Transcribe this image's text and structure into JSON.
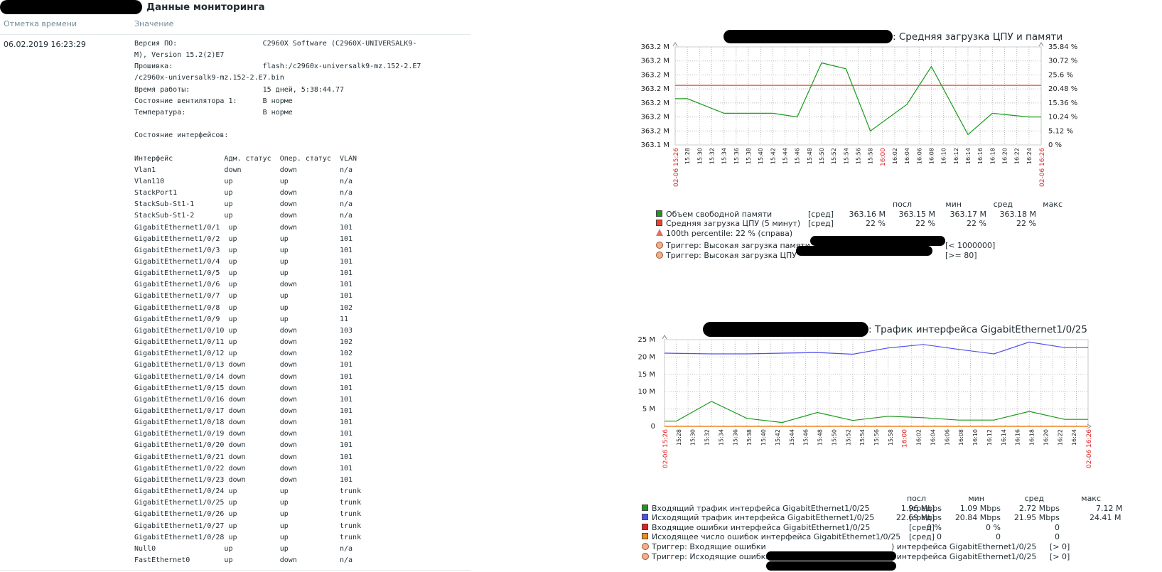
{
  "page": {
    "title_suffix": "Данные мониторинга",
    "col_time": "Отметка времени",
    "col_value": "Значение",
    "timestamp": "06.02.2019 16:23:29",
    "value_text": "Версия ПО:                    C2960X Software (C2960X-UNIVERSALK9-\nM), Version 15.2(2)E7\nПрошивка:                     flash:/c2960x-universalk9-mz.152-2.E7\n/c2960x-universalk9-mz.152-2.E7.bin\nВремя работы:                 15 дней, 5:38:44.77\nСостояние вентилятора 1:      В норме\nТемпература:                  В норме\n\nСостояние интерфейсов:\n\nИнтерфейс            Адм. статус  Опер. статус  VLAN\nVlan1                down         down          n/a\nVlan110              up           up            n/a\nStackPort1           up           down          n/a\nStackSub-St1-1       up           down          n/a\nStackSub-St1-2       up           down          n/a\nGigabitEthernet1/0/1  up          down          101\nGigabitEthernet1/0/2  up          up            101\nGigabitEthernet1/0/3  up          up            101\nGigabitEthernet1/0/4  up          up            101\nGigabitEthernet1/0/5  up          up            101\nGigabitEthernet1/0/6  up          down          101\nGigabitEthernet1/0/7  up          up            101\nGigabitEthernet1/0/8  up          up            102\nGigabitEthernet1/0/9  up          up            11\nGigabitEthernet1/0/10 up          down          103\nGigabitEthernet1/0/11 up          down          102\nGigabitEthernet1/0/12 up          down          102\nGigabitEthernet1/0/13 down        down          101\nGigabitEthernet1/0/14 down        down          101\nGigabitEthernet1/0/15 down        down          101\nGigabitEthernet1/0/16 down        down          101\nGigabitEthernet1/0/17 down        down          101\nGigabitEthernet1/0/18 down        down          101\nGigabitEthernet1/0/19 down        down          101\nGigabitEthernet1/0/20 down        down          101\nGigabitEthernet1/0/21 down        down          101\nGigabitEthernet1/0/22 down        down          101\nGigabitEthernet1/0/23 down        down          101\nGigabitEthernet1/0/24 up          up            trunk\nGigabitEthernet1/0/25 up          up            trunk\nGigabitEthernet1/0/26 up          up            trunk\nGigabitEthernet1/0/27 up          up            trunk\nGigabitEthernet1/0/28 up          up            trunk\nNull0                up           up            n/a\nFastEthernet0        up           down          n/a"
  },
  "graph1": {
    "title": ": Средняя загрузка ЦПУ  и памяти",
    "legend_header": [
      "посл",
      "мин",
      "сред",
      "макс"
    ],
    "items": [
      {
        "label": "Объем свободной памяти",
        "agg": "[сред]",
        "last": "363.16 M",
        "min": "363.15 M",
        "avg": "363.17 M",
        "max": "363.18 M",
        "color": "#1a9a1a"
      },
      {
        "label": "Средняя загрузка ЦПУ (5 минут)",
        "agg": "[сред]",
        "last": "22 %",
        "min": "22 %",
        "avg": "22 %",
        "max": "22 %",
        "color": "#e8442a"
      }
    ],
    "percentile": "100th percentile: 22 % (справа)",
    "triggers": [
      {
        "label": "Триггер: Высокая загрузка памяти",
        "cond": "[< 1000000]"
      },
      {
        "label": "Триггер: Высокая загрузка ЦПУ",
        "cond": "[>= 80]"
      }
    ]
  },
  "graph2": {
    "title": ": Трафик интерфейса GigabitEthernet1/0/25",
    "legend_header": [
      "посл",
      "мин",
      "сред",
      "макс"
    ],
    "items": [
      {
        "label": "Входящий трафик интерфейса GigabitEthernet1/0/25",
        "agg": "[сред]",
        "last": "1.96 Mbps",
        "min": "1.09 Mbps",
        "avg": "2.72 Mbps",
        "max": "7.12 M",
        "color": "#1a9a1a"
      },
      {
        "label": "Исходящий трафик интерфейса GigabitEthernet1/0/25",
        "agg": "[сред]",
        "last": "22.69 Mbps",
        "min": "20.84 Mbps",
        "avg": "21.95 Mbps",
        "max": "24.41 M",
        "color": "#5050f0"
      },
      {
        "label": "Входящие ошибки интерфейса GigabitEthernet1/0/25",
        "agg": "[сред]",
        "last": "0 %",
        "min": "0 %",
        "avg": "0",
        "max": "",
        "color": "#e02020"
      },
      {
        "label": "Исходящее число ошибок интерфейса GigabitEthernet1/0/25",
        "agg": "[сред]",
        "last": "0",
        "min": "0",
        "avg": "0",
        "max": "",
        "color": "#f08c1a"
      }
    ],
    "triggers": [
      {
        "label": "Триггер: Входящие ошибки",
        "tail": ") интерфейса GigabitEthernet1/0/25",
        "cond": "[> 0]"
      },
      {
        "label": "Триггер: Исходящие ошибки",
        "tail": ") интерфейса GigabitEthernet1/0/25",
        "cond": "[> 0]"
      }
    ]
  },
  "chart_data": [
    {
      "type": "line",
      "title": ": Средняя загрузка ЦПУ  и памяти",
      "x": [
        "15:26",
        "15:28",
        "15:30",
        "15:32",
        "15:34",
        "15:36",
        "15:38",
        "15:40",
        "15:42",
        "15:44",
        "15:46",
        "15:48",
        "15:50",
        "15:52",
        "15:54",
        "15:56",
        "15:58",
        "16:00",
        "16:02",
        "16:04",
        "16:06",
        "16:08",
        "16:10",
        "16:12",
        "16:14",
        "16:16",
        "16:18",
        "16:20",
        "16:22",
        "16:24",
        "16:26"
      ],
      "x_edge_labels": [
        "02-06 15:26",
        "02-06 16:26"
      ],
      "x_highlight": "16:00",
      "left_ticks": [
        "363.2 M",
        "363.2 M",
        "363.2 M",
        "363.2 M",
        "363.2 M",
        "363.2 M",
        "363.2 M",
        "363.1 M"
      ],
      "right_ticks": [
        "35.84 %",
        "30.72 %",
        "25.6 %",
        "20.48 %",
        "15.36 %",
        "10.24 %",
        "5.12 %",
        "0 %"
      ],
      "series": [
        {
          "name": "Объем свободной памяти",
          "axis": "left",
          "color": "#1a9a1a",
          "points": [
            [
              0,
              363.1665
            ],
            [
              1,
              363.1665
            ],
            [
              4,
              363.1613
            ],
            [
              8,
              363.1613
            ],
            [
              10,
              363.16
            ],
            [
              12,
              363.1793
            ],
            [
              14,
              363.1772
            ],
            [
              16,
              363.155
            ],
            [
              19,
              363.1645
            ],
            [
              21,
              363.178
            ],
            [
              24,
              363.1537
            ],
            [
              26,
              363.1613
            ],
            [
              29,
              363.16
            ],
            [
              30,
              363.16
            ]
          ]
        },
        {
          "name": "Средняя загрузка ЦПУ (5 минут)",
          "axis": "right",
          "color": "#e8442a",
          "points": [
            [
              0,
              21.8
            ],
            [
              30,
              21.8
            ]
          ]
        }
      ],
      "y_left_range": [
        363.15,
        363.185
      ],
      "y_right_range": [
        0,
        35.84
      ],
      "grid": true
    },
    {
      "type": "line",
      "title": ": Трафик интерфейса GigabitEthernet1/0/25",
      "x": [
        "15:26",
        "15:28",
        "15:30",
        "15:32",
        "15:34",
        "15:36",
        "15:38",
        "15:40",
        "15:42",
        "15:44",
        "15:46",
        "15:48",
        "15:50",
        "15:52",
        "15:54",
        "15:56",
        "15:58",
        "16:00",
        "16:02",
        "16:04",
        "16:06",
        "16:08",
        "16:10",
        "16:12",
        "16:14",
        "16:16",
        "16:18",
        "16:20",
        "16:22",
        "16:24",
        "16:26"
      ],
      "x_edge_labels": [
        "02-06 15:26",
        "02-06 16:26"
      ],
      "x_highlight": "16:00",
      "y_ticks": [
        "25 M",
        "20 M",
        "15 M",
        "10 M",
        "5 M",
        "0"
      ],
      "y_range": [
        0,
        25
      ],
      "series": [
        {
          "name": "Входящий трафик интерфейса GigabitEthernet1/0/25",
          "color": "#1a9a1a",
          "points": [
            [
              0,
              1.5
            ],
            [
              1,
              1.5
            ],
            [
              4,
              7.2
            ],
            [
              7,
              2.3
            ],
            [
              10,
              1.1
            ],
            [
              13,
              4.0
            ],
            [
              16,
              1.7
            ],
            [
              19,
              2.9
            ],
            [
              22,
              2.5
            ],
            [
              25,
              1.8
            ],
            [
              28,
              1.8
            ],
            [
              31,
              4.3
            ],
            [
              34,
              2.0
            ],
            [
              36,
              2.0
            ]
          ]
        },
        {
          "name": "Исходящий трафик интерфейса GigabitEthernet1/0/25",
          "color": "#5050f0",
          "points": [
            [
              0,
              21.1
            ],
            [
              4,
              20.9
            ],
            [
              7,
              20.9
            ],
            [
              10,
              21.1
            ],
            [
              13,
              21.3
            ],
            [
              16,
              20.8
            ],
            [
              19,
              22.6
            ],
            [
              22,
              23.6
            ],
            [
              25,
              22.2
            ],
            [
              28,
              20.9
            ],
            [
              31,
              24.3
            ],
            [
              34,
              22.7
            ],
            [
              36,
              22.7
            ]
          ]
        },
        {
          "name": "Входящие ошибки интерфейса GigabitEthernet1/0/25",
          "color": "#e02020",
          "points": [
            [
              0,
              0
            ],
            [
              36,
              0
            ]
          ]
        },
        {
          "name": "Исходящее число ошибок интерфейса GigabitEthernet1/0/25",
          "color": "#f08c1a",
          "points": [
            [
              0,
              0
            ],
            [
              36,
              0
            ]
          ]
        }
      ],
      "grid": true
    }
  ]
}
